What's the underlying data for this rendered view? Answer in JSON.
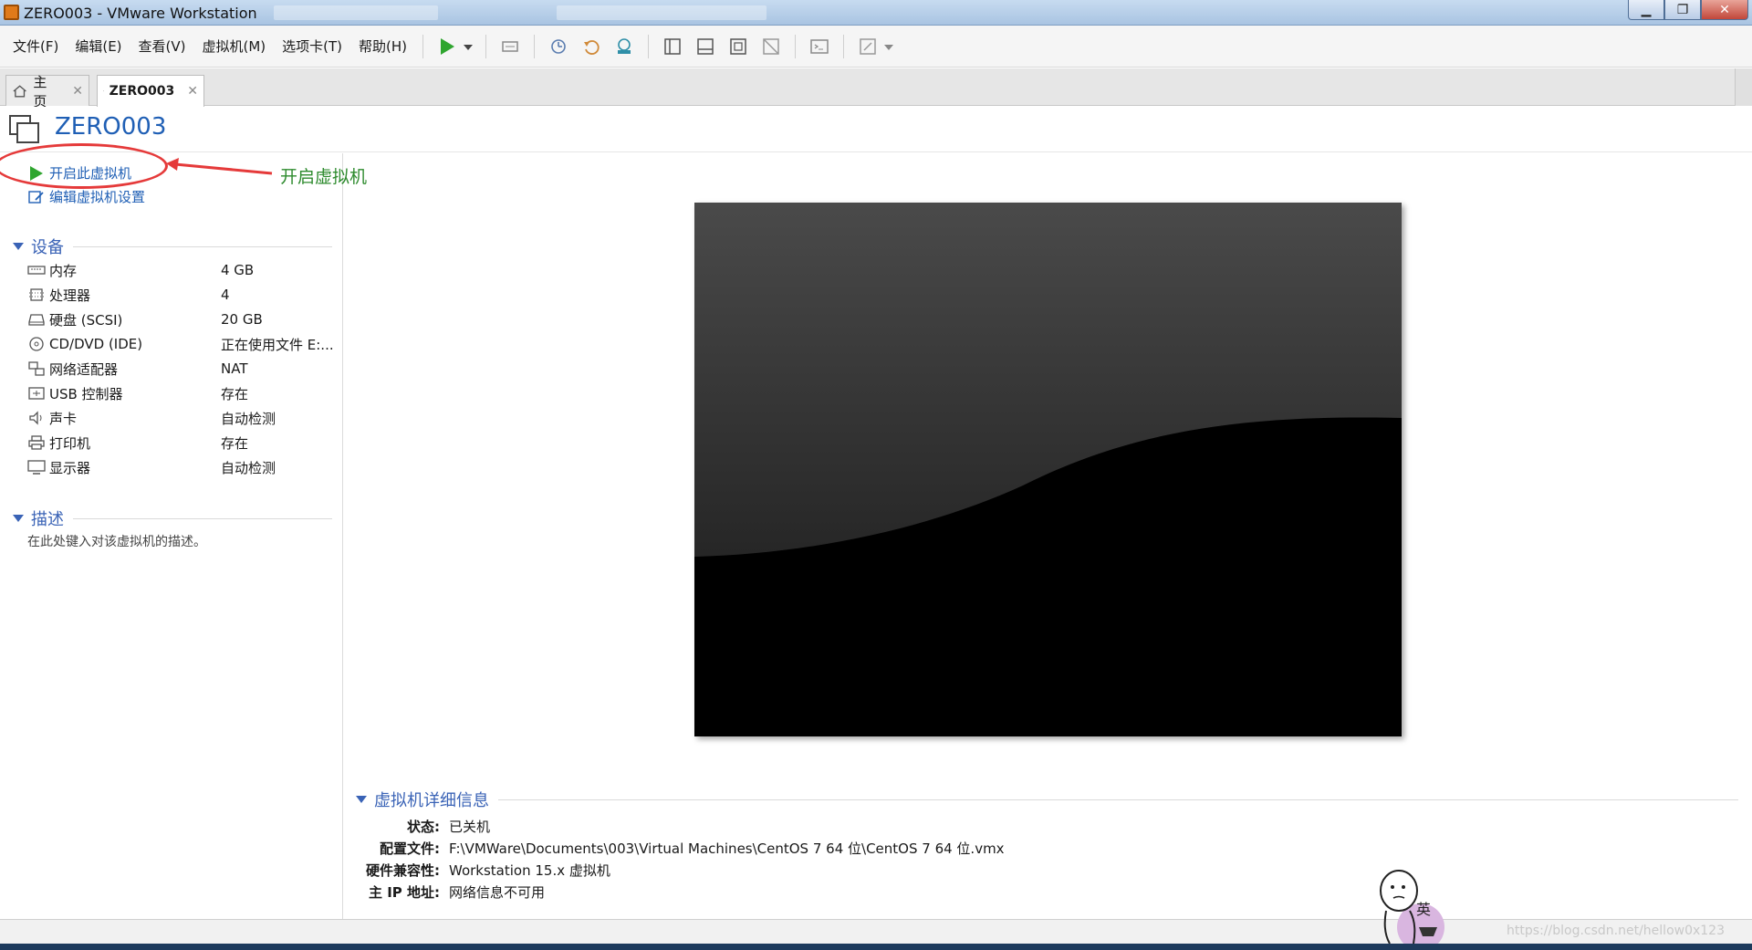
{
  "window": {
    "title": "ZERO003 - VMware Workstation"
  },
  "menu": [
    "文件(F)",
    "编辑(E)",
    "查看(V)",
    "虚拟机(M)",
    "选项卡(T)",
    "帮助(H)"
  ],
  "tabs": [
    {
      "label": "主页",
      "icon": "home-icon"
    },
    {
      "label": "ZERO003",
      "icon": "vm-icon"
    }
  ],
  "vm": {
    "name": "ZERO003"
  },
  "actions": {
    "power_on": "开启此虚拟机",
    "edit_settings": "编辑虚拟机设置"
  },
  "devices": {
    "heading": "设备",
    "items": [
      {
        "icon": "memory-icon",
        "name": "内存",
        "value": "4 GB"
      },
      {
        "icon": "cpu-icon",
        "name": "处理器",
        "value": "4"
      },
      {
        "icon": "harddisk-icon",
        "name": "硬盘 (SCSI)",
        "value": "20 GB"
      },
      {
        "icon": "cd-icon",
        "name": "CD/DVD (IDE)",
        "value": "正在使用文件 E:..."
      },
      {
        "icon": "network-icon",
        "name": "网络适配器",
        "value": "NAT"
      },
      {
        "icon": "usb-icon",
        "name": "USB 控制器",
        "value": "存在"
      },
      {
        "icon": "speaker-icon",
        "name": "声卡",
        "value": "自动检测"
      },
      {
        "icon": "printer-icon",
        "name": "打印机",
        "value": "存在"
      },
      {
        "icon": "monitor-icon",
        "name": "显示器",
        "value": "自动检测"
      }
    ]
  },
  "description": {
    "heading": "描述",
    "placeholder": "在此处键入对该虚拟机的描述。"
  },
  "details": {
    "heading": "虚拟机详细信息",
    "rows": [
      {
        "key": "状态:",
        "value": "已关机"
      },
      {
        "key": "配置文件:",
        "value": "F:\\VMWare\\Documents\\003\\Virtual Machines\\CentOS 7 64 位\\CentOS 7 64 位.vmx"
      },
      {
        "key": "硬件兼容性:",
        "value": "Workstation 15.x 虚拟机"
      },
      {
        "key": "主 IP 地址:",
        "value": "网络信息不可用"
      }
    ]
  },
  "annotation": {
    "text": "开启虚拟机",
    "color": "#e53a3a"
  },
  "mascot": {
    "char": "英"
  },
  "watermark": "https://blog.csdn.net/hellow0x123",
  "colors": {
    "link": "#1f5fb5",
    "section": "#3a63b6",
    "play": "#2fa52f"
  }
}
